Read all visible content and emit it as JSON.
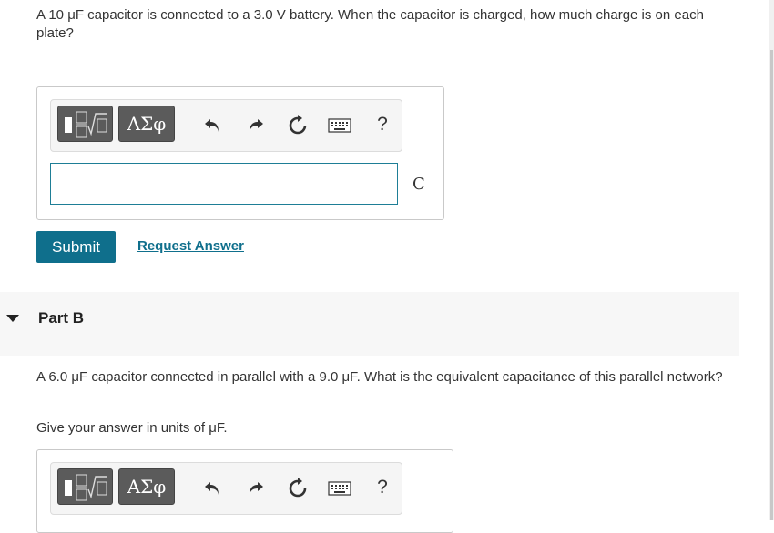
{
  "partA": {
    "question": "A 10 μF capacitor is connected to a 3.0 V battery. When the capacitor is charged, how much charge is on each plate?",
    "answer_value": "",
    "unit": "C",
    "toolbar": {
      "symbols_label": "ΑΣφ",
      "help_label": "?"
    },
    "submit_label": "Submit",
    "request_label": "Request Answer"
  },
  "partB": {
    "title": "Part B",
    "question": "A 6.0 μF capacitor connected in parallel with a 9.0 μF.  What is the equivalent capacitance of this parallel network?",
    "instruction": "Give your answer in units of μF.",
    "toolbar": {
      "symbols_label": "ΑΣφ",
      "help_label": "?"
    }
  },
  "colors": {
    "accent": "#0f6f8c",
    "toolbar_dark": "#5b5b5b",
    "input_border": "#1e7e96",
    "part_header_bg": "#f7f7f7"
  },
  "icons": [
    "templates-icon",
    "undo-icon",
    "redo-icon",
    "reset-icon",
    "keyboard-icon",
    "help-icon",
    "collapse-caret-icon"
  ]
}
